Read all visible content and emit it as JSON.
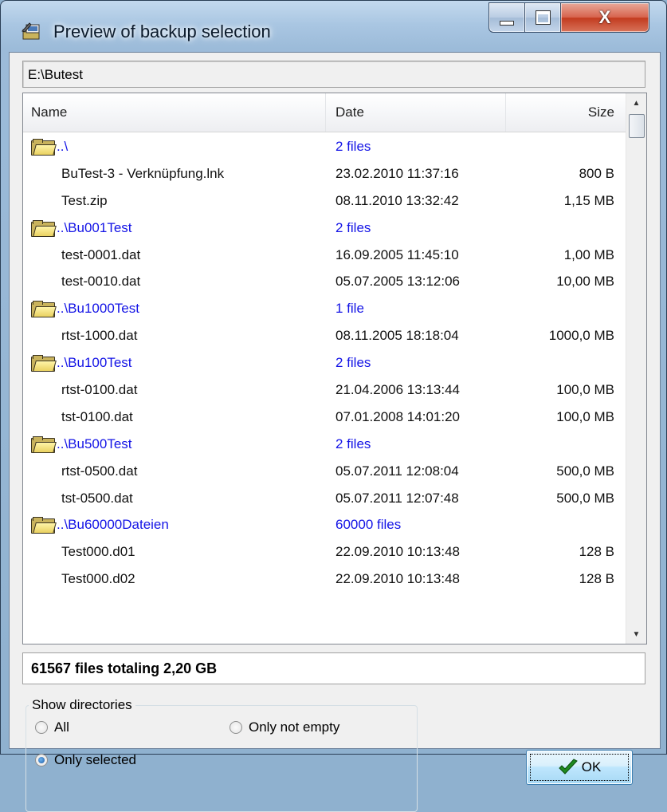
{
  "window": {
    "title": "Preview of backup selection"
  },
  "path": "E:\\Butest",
  "list": {
    "columns": {
      "name": "Name",
      "date": "Date",
      "size": "Size"
    },
    "rows": [
      {
        "type": "dir",
        "name": "..\\",
        "date": "2 files",
        "size": ""
      },
      {
        "type": "file",
        "name": "BuTest-3 - Verknüpfung.lnk",
        "date": "23.02.2010 11:37:16",
        "size": "800 B"
      },
      {
        "type": "file",
        "name": "Test.zip",
        "date": "08.11.2010 13:32:42",
        "size": "1,15 MB"
      },
      {
        "type": "dir",
        "name": "..\\Bu001Test",
        "date": "2 files",
        "size": ""
      },
      {
        "type": "file",
        "name": "test-0001.dat",
        "date": "16.09.2005 11:45:10",
        "size": "1,00 MB"
      },
      {
        "type": "file",
        "name": "test-0010.dat",
        "date": "05.07.2005 13:12:06",
        "size": "10,00 MB"
      },
      {
        "type": "dir",
        "name": "..\\Bu1000Test",
        "date": "1 file",
        "size": ""
      },
      {
        "type": "file",
        "name": "rtst-1000.dat",
        "date": "08.11.2005 18:18:04",
        "size": "1000,0 MB"
      },
      {
        "type": "dir",
        "name": "..\\Bu100Test",
        "date": "2 files",
        "size": ""
      },
      {
        "type": "file",
        "name": "rtst-0100.dat",
        "date": "21.04.2006 13:13:44",
        "size": "100,0 MB"
      },
      {
        "type": "file",
        "name": "tst-0100.dat",
        "date": "07.01.2008 14:01:20",
        "size": "100,0 MB"
      },
      {
        "type": "dir",
        "name": "..\\Bu500Test",
        "date": "2 files",
        "size": ""
      },
      {
        "type": "file",
        "name": "rtst-0500.dat",
        "date": "05.07.2011 12:08:04",
        "size": "500,0 MB"
      },
      {
        "type": "file",
        "name": "tst-0500.dat",
        "date": "05.07.2011 12:07:48",
        "size": "500,0 MB"
      },
      {
        "type": "dir",
        "name": "..\\Bu60000Dateien",
        "date": "60000 files",
        "size": ""
      },
      {
        "type": "file",
        "name": "Test000.d01",
        "date": "22.09.2010 10:13:48",
        "size": "128 B"
      },
      {
        "type": "file",
        "name": "Test000.d02",
        "date": "22.09.2010 10:13:48",
        "size": "128 B"
      }
    ]
  },
  "summary": "61567 files totaling 2,20 GB",
  "show_directories": {
    "legend": "Show directories",
    "options": [
      {
        "label": "All",
        "checked": false
      },
      {
        "label": "Only not empty",
        "checked": false
      },
      {
        "label": "Only selected",
        "checked": true
      }
    ]
  },
  "ok_button": {
    "label": "OK"
  },
  "colors": {
    "directory_text": "#1414e6",
    "title_bar": "#a9c6e2"
  },
  "icons": [
    "app-backup-icon",
    "minimize-icon",
    "maximize-icon",
    "close-icon",
    "folder-icon",
    "checkmark-icon"
  ]
}
